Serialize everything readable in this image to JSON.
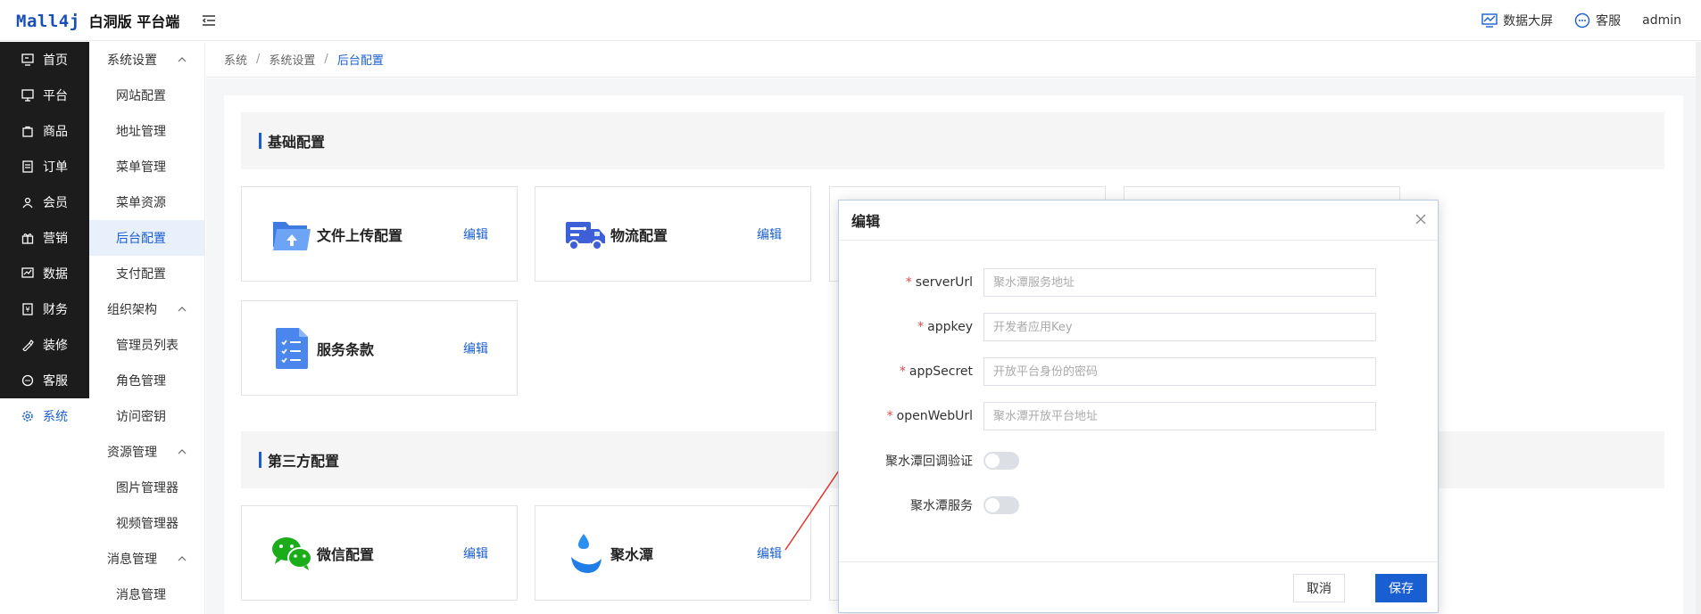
{
  "header": {
    "logo_brand": "Mall4j",
    "logo_text": "白洞版 平台端",
    "dashboard_label": "数据大屏",
    "service_label": "客服",
    "user": "admin"
  },
  "sidebar": {
    "items": [
      {
        "label": "首页",
        "icon": "monitor-icon"
      },
      {
        "label": "平台",
        "icon": "screen-icon"
      },
      {
        "label": "商品",
        "icon": "bag-icon"
      },
      {
        "label": "订单",
        "icon": "document-icon"
      },
      {
        "label": "会员",
        "icon": "user-group-icon"
      },
      {
        "label": "营销",
        "icon": "gift-icon"
      },
      {
        "label": "数据",
        "icon": "chart-icon"
      },
      {
        "label": "财务",
        "icon": "finance-icon"
      },
      {
        "label": "装修",
        "icon": "paint-icon"
      },
      {
        "label": "客服",
        "icon": "chat-icon"
      },
      {
        "label": "系统",
        "icon": "gear-icon"
      }
    ]
  },
  "subnav": {
    "groups": [
      {
        "label": "系统设置",
        "items": [
          "网站配置",
          "地址管理",
          "菜单管理",
          "菜单资源",
          "后台配置",
          "支付配置"
        ]
      },
      {
        "label": "组织架构",
        "items": [
          "管理员列表",
          "角色管理",
          "访问密钥"
        ]
      },
      {
        "label": "资源管理",
        "items": [
          "图片管理器",
          "视频管理器"
        ]
      },
      {
        "label": "消息管理",
        "items": [
          "消息管理"
        ]
      }
    ]
  },
  "breadcrumb": [
    "系统",
    "系统设置",
    "后台配置"
  ],
  "sections": {
    "basic": "基础配置",
    "third_party": "第三方配置"
  },
  "cards": {
    "file_upload": "文件上传配置",
    "logistics": "物流配置",
    "terms": "服务条款",
    "wechat": "微信配置",
    "jushuitan": "聚水潭",
    "edit": "编辑"
  },
  "dialog": {
    "title": "编辑",
    "fields": [
      {
        "label": "serverUrl",
        "placeholder": "聚水潭服务地址",
        "required": true
      },
      {
        "label": "appkey",
        "placeholder": "开发者应用Key",
        "required": true
      },
      {
        "label": "appSecret",
        "placeholder": "开放平台身份的密码",
        "required": true
      },
      {
        "label": "openWebUrl",
        "placeholder": "聚水潭开放平台地址",
        "required": true
      }
    ],
    "toggles": [
      {
        "label": "聚水潭回调验证",
        "on": false
      },
      {
        "label": "聚水潭服务",
        "on": false
      }
    ],
    "required_mark": "*",
    "cancel": "取消",
    "save": "保存"
  },
  "colors": {
    "accent": "#1a5fd1",
    "sidebar_bg": "#1c1c1c"
  }
}
